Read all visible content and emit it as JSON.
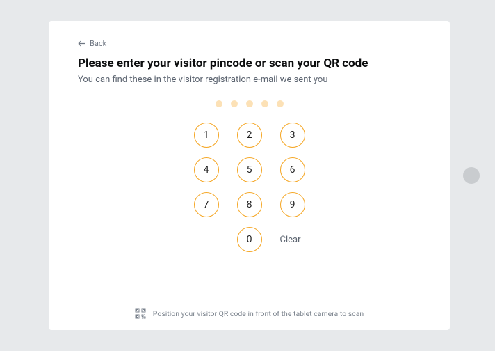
{
  "back": {
    "label": "Back"
  },
  "heading": "Please enter your visitor pincode or scan your QR code",
  "subtitle": "You can find these in the visitor registration e-mail we sent you",
  "pin": {
    "length": 5
  },
  "keypad": {
    "keys": [
      "1",
      "2",
      "3",
      "4",
      "5",
      "6",
      "7",
      "8",
      "9",
      "0"
    ],
    "clear_label": "Clear"
  },
  "qr_hint": "Position your visitor QR code in front of the tablet camera to scan",
  "colors": {
    "accent": "#F5A623",
    "dot": "#FCE1B6"
  }
}
